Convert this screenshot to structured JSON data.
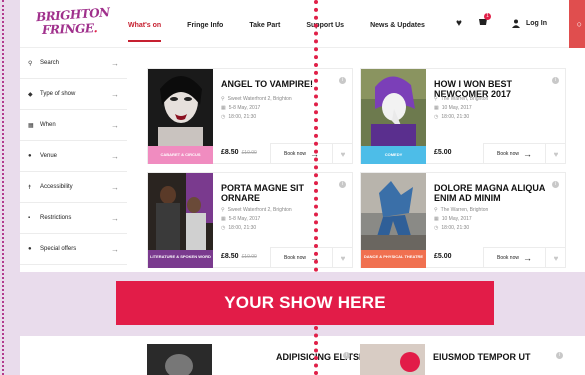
{
  "logo": {
    "line1": "BRIGHTON",
    "line2": "FRINGE",
    "dot": "."
  },
  "nav": [
    {
      "label": "What's on",
      "active": true
    },
    {
      "label": "Fringe Info",
      "active": false
    },
    {
      "label": "Take Part",
      "active": false
    },
    {
      "label": "Support Us",
      "active": false
    },
    {
      "label": "News & Updates",
      "active": false
    }
  ],
  "header": {
    "cart_count": "1",
    "login_label": "Log In"
  },
  "filters": [
    {
      "label": "Search",
      "icon": "search-icon"
    },
    {
      "label": "Type of show",
      "icon": "tag-icon"
    },
    {
      "label": "When",
      "icon": "calendar-icon"
    },
    {
      "label": "Venue",
      "icon": "location-pin-icon"
    },
    {
      "label": "Accessibility",
      "icon": "accessibility-icon"
    },
    {
      "label": "Restrictions",
      "icon": "lock-icon"
    },
    {
      "label": "Special offers",
      "icon": "offer-icon"
    }
  ],
  "shows": [
    {
      "title": "ANGEL TO VAMPIRE!",
      "venue": "Sweet Waterfront 2, Brighton",
      "dates": "5-8 May, 2017",
      "times": "18:00, 21:30",
      "price": "£8.50",
      "old_price": "£10.00",
      "book_label": "Book now",
      "category": "CABARET & CIRCUS",
      "category_color": "#f08cc0"
    },
    {
      "title": "HOW I WON BEST NEWCOMER 2017",
      "venue": "The Warren, Brighton",
      "dates": "10 May, 2017",
      "times": "18:00, 21:30",
      "price": "£5.00",
      "old_price": "",
      "book_label": "Book now",
      "category": "COMEDY",
      "category_color": "#4dbde8"
    },
    {
      "title": "PORTA MAGNE SIT ORNARE",
      "venue": "Sweet Waterfront 2, Brighton",
      "dates": "5-8 May, 2017",
      "times": "18:00, 21:30",
      "price": "£8.50",
      "old_price": "£10.00",
      "book_label": "Book now",
      "category": "LITERATURE & SPOKEN WORD",
      "category_color": "#7a3a8e"
    },
    {
      "title": "DOLORE MAGNA ALIQUA ENIM AD MINIM",
      "venue": "The Warren, Brighton",
      "dates": "10 May, 2017",
      "times": "18:00, 21:30",
      "price": "£5.00",
      "old_price": "",
      "book_label": "Book now",
      "category": "DANCE & PHYSICAL THEATRE",
      "category_color": "#f07050"
    }
  ],
  "banner": {
    "text": "YOUR SHOW HERE"
  },
  "lower": [
    {
      "title": "ADIPISICING ELITSED DO"
    },
    {
      "title": "EIUSMOD TEMPOR UT"
    }
  ],
  "colors": {
    "accent": "#e21c48",
    "brand_purple": "#a0308c",
    "background": "#e9dcec"
  }
}
